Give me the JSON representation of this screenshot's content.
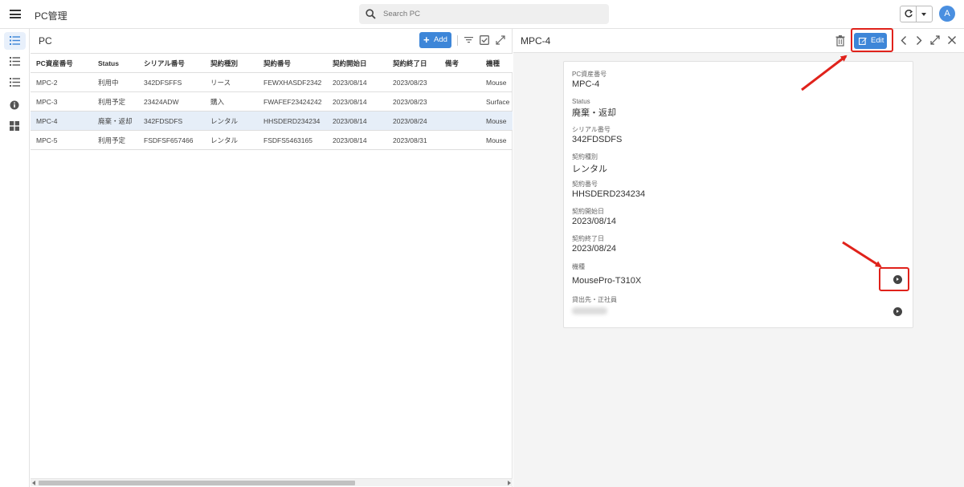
{
  "app": {
    "title": "PC管理",
    "avatar_initial": "A"
  },
  "search": {
    "placeholder": "Search PC",
    "value": ""
  },
  "rail": {
    "items": [
      "list-icon",
      "list-icon",
      "list-icon",
      "info-icon",
      "grid-icon"
    ],
    "active_index": 0
  },
  "list": {
    "title": "PC",
    "add_label": "Add",
    "columns": [
      "PC資産番号",
      "Status",
      "シリアル番号",
      "契約種別",
      "契約番号",
      "契約開始日",
      "契約終了日",
      "備考",
      "機種"
    ],
    "rows": [
      [
        "MPC-2",
        "利用中",
        "342DFSFFS",
        "リース",
        "FEWXHASDF2342",
        "2023/08/14",
        "2023/08/23",
        "",
        "Mouse"
      ],
      [
        "MPC-3",
        "利用予定",
        "23424ADW",
        "購入",
        "FWAFEF23424242",
        "2023/08/14",
        "2023/08/23",
        "",
        "Surface"
      ],
      [
        "MPC-4",
        "廃棄・返却",
        "342FDSDFS",
        "レンタル",
        "HHSDERD234234",
        "2023/08/14",
        "2023/08/24",
        "",
        "Mouse"
      ],
      [
        "MPC-5",
        "利用予定",
        "FSDFSF657466",
        "レンタル",
        "FSDFS5463165",
        "2023/08/14",
        "2023/08/31",
        "",
        "Mouse"
      ]
    ],
    "selected_row_index": 2
  },
  "detail": {
    "title": "MPC-4",
    "edit_label": "Edit",
    "fields": [
      {
        "label": "PC資産番号",
        "value": "MPC-4"
      },
      {
        "label": "Status",
        "value": "廃棄・返却"
      },
      {
        "label": "シリアル番号",
        "value": "342FDSDFS"
      },
      {
        "label": "契約種別",
        "value": "レンタル"
      },
      {
        "label": "契約番号",
        "value": "HHSDERD234234"
      },
      {
        "label": "契約開始日",
        "value": "2023/08/14"
      },
      {
        "label": "契約終了日",
        "value": "2023/08/24"
      },
      {
        "label": "機種",
        "value": "MousePro-T310X"
      },
      {
        "label": "貸出先・正社員",
        "value": ""
      }
    ]
  },
  "colors": {
    "accent": "#3d86d8",
    "selected_row": "#e6eef8",
    "annotation": "#e0221b"
  }
}
